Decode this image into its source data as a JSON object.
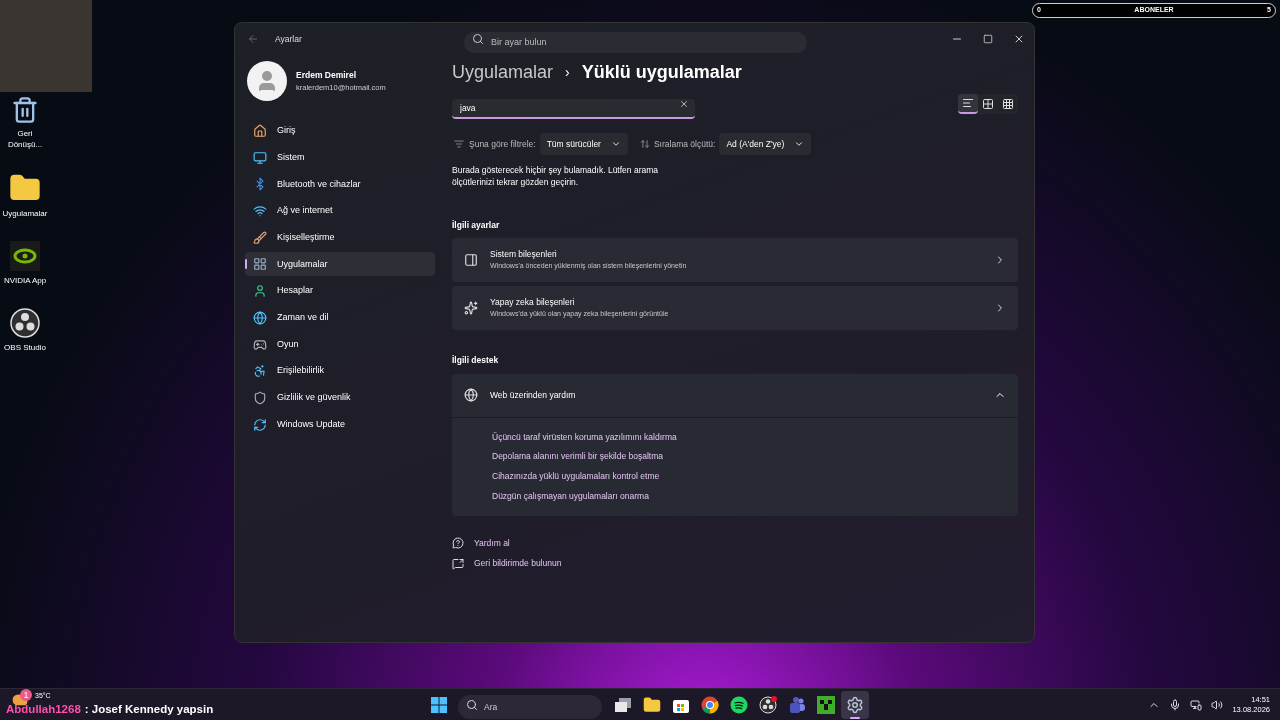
{
  "overlay": {
    "subscriber_bar": {
      "start": "0",
      "label": "ABONELER",
      "end": "5"
    },
    "chat": {
      "user": "Abdullah1268",
      "message": ": Josef Kennedy yapsin"
    }
  },
  "desktop_icons": [
    {
      "label": "Geri Dönüşü...",
      "kind": "recycle"
    },
    {
      "label": "Uygulamalar",
      "kind": "folder"
    },
    {
      "label": "NVIDIA App",
      "kind": "nvidia"
    },
    {
      "label": "OBS Studio",
      "kind": "obs"
    }
  ],
  "window": {
    "title": "Ayarlar",
    "search": {
      "placeholder": "Bir ayar bulun"
    },
    "user": {
      "name": "Erdem Demirel",
      "email": "kralerdem10@hotmail.com"
    },
    "sidebar": {
      "items": [
        {
          "label": "Giriş",
          "kind": "home",
          "selected": false
        },
        {
          "label": "Sistem",
          "kind": "system",
          "selected": false
        },
        {
          "label": "Bluetooth ve cihazlar",
          "kind": "bluetooth",
          "selected": false
        },
        {
          "label": "Ağ ve internet",
          "kind": "network",
          "selected": false
        },
        {
          "label": "Kişiselleştirme",
          "kind": "personalization",
          "selected": false
        },
        {
          "label": "Uygulamalar",
          "kind": "apps",
          "selected": true
        },
        {
          "label": "Hesaplar",
          "kind": "accounts",
          "selected": false
        },
        {
          "label": "Zaman ve dil",
          "kind": "time",
          "selected": false
        },
        {
          "label": "Oyun",
          "kind": "gaming",
          "selected": false
        },
        {
          "label": "Erişilebilirlik",
          "kind": "accessibility",
          "selected": false
        },
        {
          "label": "Gizlilik ve güvenlik",
          "kind": "privacy",
          "selected": false
        },
        {
          "label": "Windows Update",
          "kind": "update",
          "selected": false
        }
      ]
    },
    "breadcrumb": {
      "parent": "Uygulamalar",
      "separator": "›",
      "current": "Yüklü uygulamalar"
    },
    "app_search": {
      "value": "java"
    },
    "view_toggles": [
      {
        "kind": "list",
        "selected": true
      },
      {
        "kind": "tiles",
        "selected": false
      },
      {
        "kind": "grid",
        "selected": false
      }
    ],
    "filter": {
      "label": "Şuna göre filtrele:",
      "value": "Tüm sürücüler"
    },
    "sort": {
      "label": "Sıralama ölçütü:",
      "value": "Ad (A'den Z'ye)"
    },
    "empty_message": "Burada gösterecek hiçbir şey bulamadık. Lütfen arama ölçütlerinizi tekrar gözden geçirin.",
    "related_settings": {
      "title": "İlgili ayarlar",
      "cards": [
        {
          "kind": "components",
          "title": "Sistem bileşenleri",
          "subtitle": "Windows'a önceden yüklenmiş olan sistem bileşenlerini yönetin"
        },
        {
          "kind": "ai",
          "title": "Yapay zeka bileşenleri",
          "subtitle": "Windows'da yüklü olan yapay zeka bileşenlerini görüntüle"
        }
      ]
    },
    "related_support": {
      "title": "İlgili destek",
      "expander": {
        "title": "Web üzerinden yardım",
        "expanded": true,
        "links": [
          "Üçüncü taraf virüsten koruma yazılımını kaldırma",
          "Depolama alanını verimli bir şekilde boşaltma",
          "Cihazınızda yüklü uygulamaları kontrol etme",
          "Düzgün çalışmayan uygulamaları onarma"
        ]
      }
    },
    "footer_links": [
      {
        "kind": "help",
        "label": "Yardım al"
      },
      {
        "kind": "feedback",
        "label": "Geri bildirimde bulunun"
      }
    ]
  },
  "taskbar": {
    "weather": {
      "badge": "1",
      "temperature": "35°C"
    },
    "search": {
      "placeholder": "Ara"
    },
    "apps": [
      {
        "kind": "taskview",
        "active": false
      },
      {
        "kind": "explorer",
        "active": false
      },
      {
        "kind": "store",
        "active": false
      },
      {
        "kind": "chrome",
        "active": false
      },
      {
        "kind": "spotify",
        "active": false
      },
      {
        "kind": "obs",
        "active": false
      },
      {
        "kind": "teams",
        "active": false
      },
      {
        "kind": "minecraft",
        "active": false
      },
      {
        "kind": "settings",
        "active": true
      }
    ],
    "time": "14:51",
    "date": "13.08.2026"
  }
}
